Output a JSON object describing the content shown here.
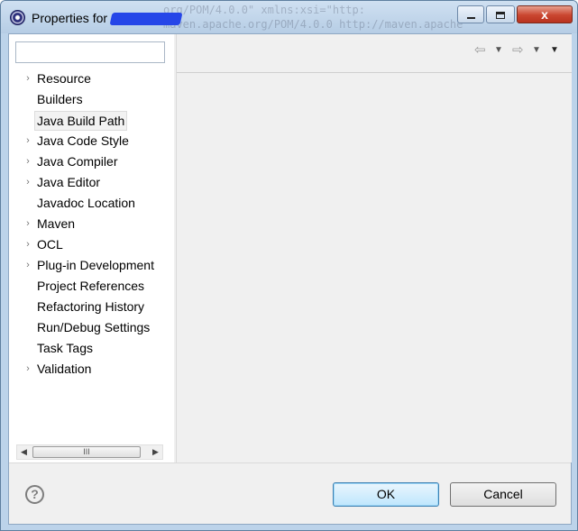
{
  "window": {
    "title_prefix": "Properties for",
    "background_code_1": "org/POM/4.0.0\" xmlns:xsi=\"http:",
    "background_code_2": "maven.apache.org/POM/4.0.0 http://maven.apache"
  },
  "window_buttons": {
    "close_label": "x"
  },
  "filter": {
    "value": ""
  },
  "tree": {
    "items": [
      {
        "label": "Resource",
        "expandable": true
      },
      {
        "label": "Builders",
        "expandable": false
      },
      {
        "label": "Java Build Path",
        "expandable": false,
        "selected": true
      },
      {
        "label": "Java Code Style",
        "expandable": true
      },
      {
        "label": "Java Compiler",
        "expandable": true
      },
      {
        "label": "Java Editor",
        "expandable": true
      },
      {
        "label": "Javadoc Location",
        "expandable": false
      },
      {
        "label": "Maven",
        "expandable": true
      },
      {
        "label": "OCL",
        "expandable": true
      },
      {
        "label": "Plug-in Development",
        "expandable": true
      },
      {
        "label": "Project References",
        "expandable": false
      },
      {
        "label": "Refactoring History",
        "expandable": false
      },
      {
        "label": "Run/Debug Settings",
        "expandable": false
      },
      {
        "label": "Task Tags",
        "expandable": false
      },
      {
        "label": "Validation",
        "expandable": true
      }
    ]
  },
  "scrollbar": {
    "thumb_grip": "III"
  },
  "buttons": {
    "ok_label": "OK",
    "cancel_label": "Cancel",
    "help_label": "?"
  },
  "icons": {
    "app": "eclipse-icon",
    "tree_arrow": "chevron-right-icon",
    "back": "back-arrow-icon",
    "forward": "forward-arrow-icon",
    "menu": "view-menu-icon",
    "help": "help-icon"
  },
  "colors": {
    "titlebar": "#bcd3ea",
    "ok_button": "#bee6fd",
    "redaction": "#2646e8"
  }
}
